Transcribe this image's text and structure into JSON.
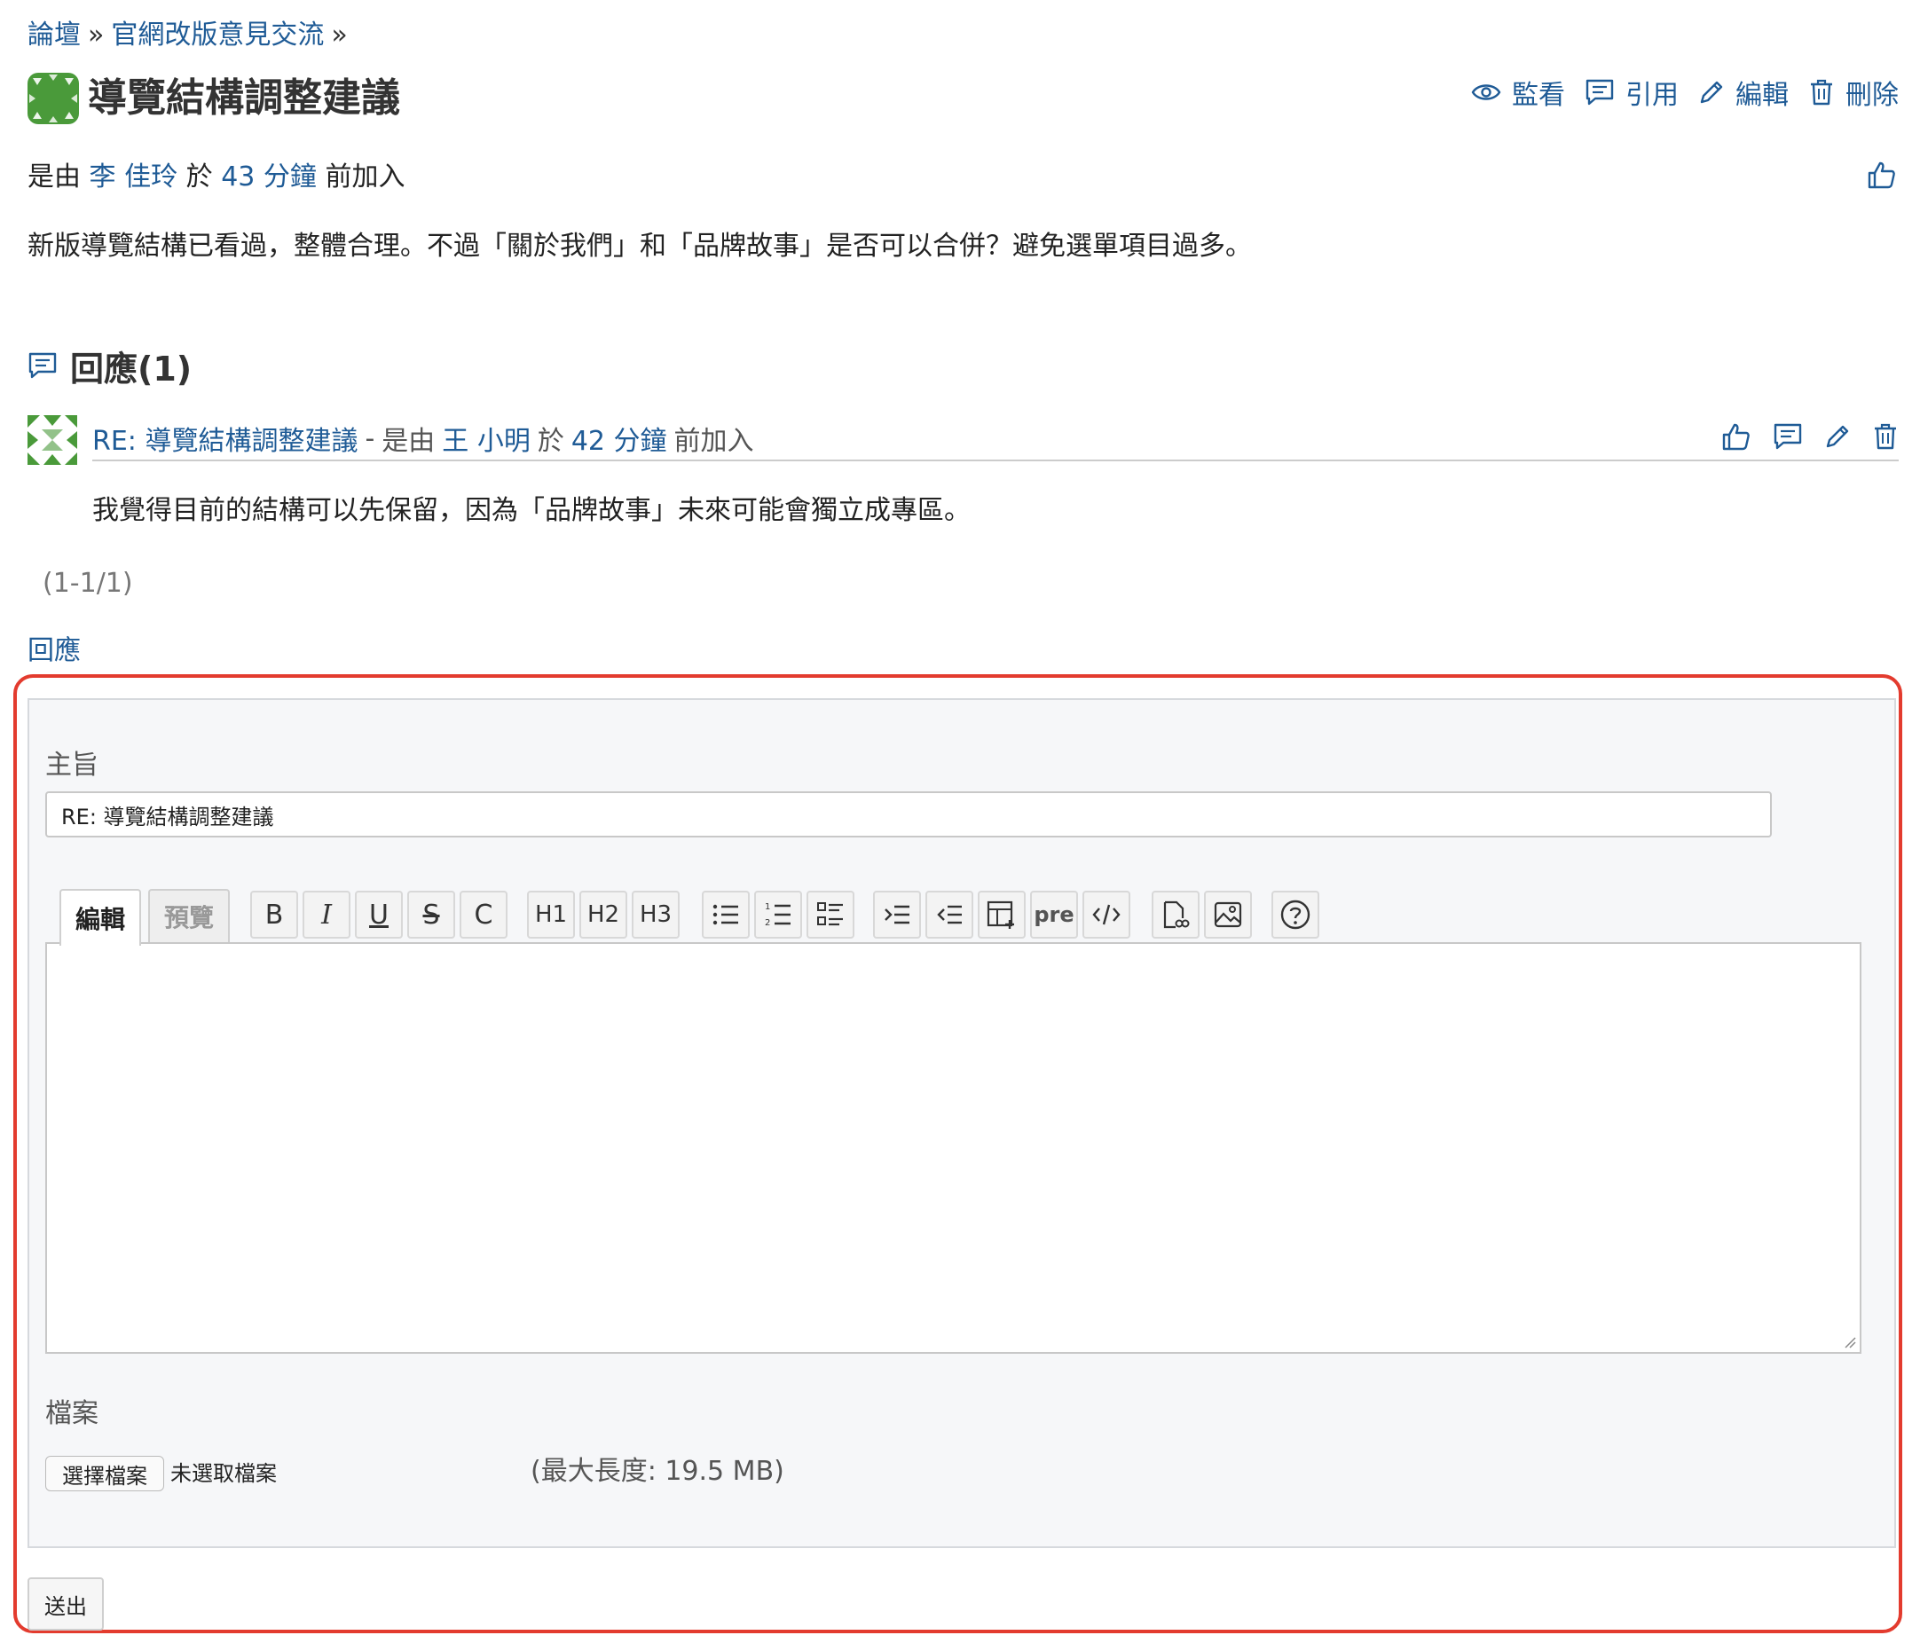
{
  "breadcrumb": {
    "root": "論壇",
    "forum": "官網改版意見交流",
    "separator": "»"
  },
  "topic": {
    "title": "導覽結構調整建議",
    "author_prefix": "是由",
    "author": "李 佳玲",
    "time_prefix": "於",
    "time": "43 分鐘",
    "time_suffix": "前加入",
    "content": "新版導覽結構已看過，整體合理。不過「關於我們」和「品牌故事」是否可以合併？避免選單項目過多。"
  },
  "actions": {
    "watch": "監看",
    "quote": "引用",
    "edit": "編輯",
    "delete": "刪除"
  },
  "replies": {
    "heading": "回應(1)",
    "items": [
      {
        "subject": "RE: 導覽結構調整建議",
        "dash": "-",
        "author_prefix": "是由",
        "author": "王 小明",
        "time_prefix": "於",
        "time": "42 分鐘",
        "time_suffix": "前加入",
        "body": "我覺得目前的結構可以先保留，因為「品牌故事」未來可能會獨立成專區。"
      }
    ],
    "pagination": "(1-1/1)"
  },
  "reply_link": "回應",
  "form": {
    "subject_label": "主旨",
    "subject_value": "RE: 導覽結構調整建議",
    "tab_edit": "編輯",
    "tab_preview": "預覽",
    "toolbar": {
      "bold": "B",
      "italic": "I",
      "underline": "U",
      "strike": "S",
      "code_inline": "C",
      "h1": "H1",
      "h2": "H2",
      "h3": "H3",
      "pre": "pre"
    },
    "files_label": "檔案",
    "choose_file": "選擇檔案",
    "no_file": "未選取檔案",
    "max_size": "(最大長度: 19.5 MB)",
    "submit": "送出"
  },
  "colors": {
    "link": "#1f5b96",
    "highlight": "#e33b2e",
    "avatar_green": "#4a9a3a"
  }
}
